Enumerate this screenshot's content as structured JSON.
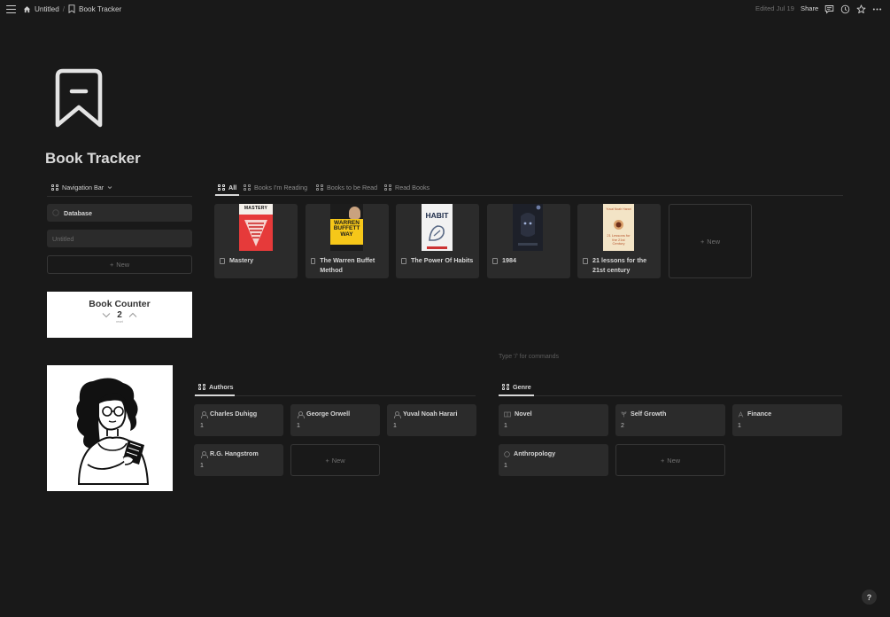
{
  "breadcrumb": {
    "parent": "Untitled",
    "separator": "/",
    "current": "Book Tracker"
  },
  "topbar": {
    "edited": "Edited Jul 19",
    "share": "Share"
  },
  "page": {
    "title": "Book Tracker"
  },
  "navbar": {
    "view_label": "Navigation Bar",
    "items": [
      {
        "label": "Database"
      },
      {
        "label": "Untitled"
      }
    ],
    "new_label": "New"
  },
  "counter": {
    "title": "Book Counter",
    "value": "2",
    "sublabel": "reset"
  },
  "books": {
    "tabs": [
      {
        "label": "All"
      },
      {
        "label": "Books I'm Reading"
      },
      {
        "label": "Books to be Read"
      },
      {
        "label": "Read Books"
      }
    ],
    "items": [
      {
        "title": "Mastery",
        "cover_text": "MASTERY"
      },
      {
        "title": "The Warren Buffet Method",
        "cover_text": "WARREN BUFFETT WAY"
      },
      {
        "title": "The Power Of Habits",
        "cover_text": "HABIT"
      },
      {
        "title": "1984",
        "cover_text": ""
      },
      {
        "title": "21 lessons for the 21st century",
        "cover_text": "21 Lessons for the 21st Century"
      }
    ],
    "new_label": "New"
  },
  "placeholder": "Type '/' for commands",
  "authors": {
    "view_label": "Authors",
    "items": [
      {
        "name": "Charles Duhigg",
        "count": "1"
      },
      {
        "name": "George Orwell",
        "count": "1"
      },
      {
        "name": "Yuval Noah Harari",
        "count": "1"
      },
      {
        "name": "R.G. Hangstrom",
        "count": "1"
      }
    ],
    "new_label": "New"
  },
  "genre": {
    "view_label": "Genre",
    "items": [
      {
        "name": "Novel",
        "count": "1"
      },
      {
        "name": "Self Growth",
        "count": "2"
      },
      {
        "name": "Finance",
        "count": "1"
      },
      {
        "name": "Anthropology",
        "count": "1"
      }
    ],
    "new_label": "New"
  },
  "help": "?"
}
